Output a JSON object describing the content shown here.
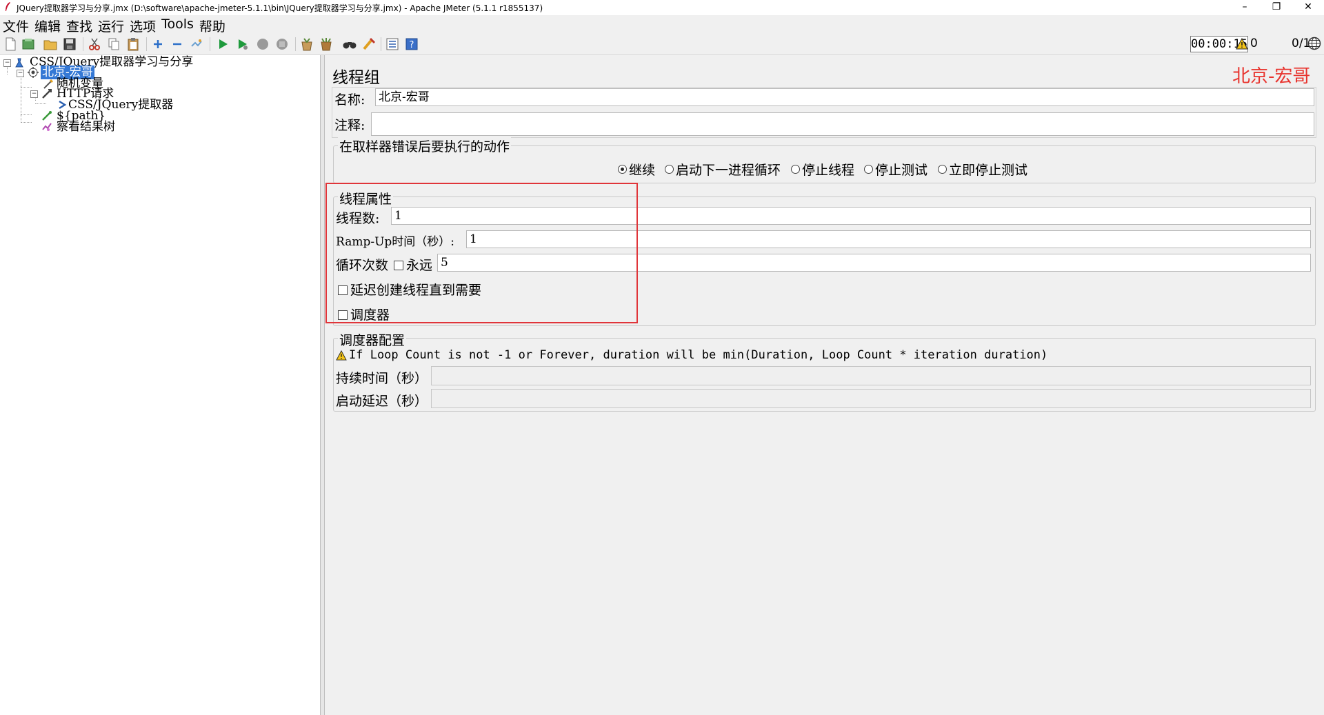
{
  "window": {
    "title": "JQuery提取器学习与分享.jmx (D:\\software\\apache-jmeter-5.1.1\\bin\\JQuery提取器学习与分享.jmx) - Apache JMeter (5.1.1 r1855137)",
    "minimize": "–",
    "maximize": "❐",
    "close": "✕"
  },
  "menu": [
    "文件",
    "编辑",
    "查找",
    "运行",
    "选项",
    "Tools",
    "帮助"
  ],
  "toolbar": {
    "icons": [
      "new-icon",
      "templates-icon",
      "open-icon",
      "save-icon",
      "cut-icon",
      "copy-icon",
      "paste-icon",
      "expand-icon",
      "collapse-icon",
      "toggle-icon",
      "start-icon",
      "start-no-pause-icon",
      "stop-icon",
      "shutdown-icon",
      "clear-icon",
      "clear-all-icon",
      "search-icon",
      "reset-search-icon",
      "function-helper-icon",
      "help-icon"
    ],
    "timer": "00:00:15",
    "warnings": "0",
    "threads": "0/1"
  },
  "tree": {
    "root": "CSS/JQuery提取器学习与分享",
    "thread_group": "北京-宏哥",
    "random_variable": "随机变量",
    "http_request": "HTTP请求",
    "css_extractor": "CSS/JQuery提取器",
    "debug_sampler": "${path}",
    "results_tree": "察看结果树"
  },
  "panel": {
    "heading": "线程组",
    "watermark": "北京-宏哥",
    "name_label": "名称:",
    "name_value": "北京-宏哥",
    "comment_label": "注释:",
    "comment_value": "",
    "error_action": {
      "title": "在取样器错误后要执行的动作",
      "options": [
        "继续",
        "启动下一进程循环",
        "停止线程",
        "停止测试",
        "立即停止测试"
      ],
      "selected": "继续"
    },
    "thread_props": {
      "title": "线程属性",
      "threads_label": "线程数:",
      "threads_value": "1",
      "rampup_label": "Ramp-Up时间（秒）:",
      "rampup_value": "1",
      "loop_label": "循环次数",
      "forever_label": "永远",
      "forever_checked": false,
      "loop_value": "5",
      "delay_label": "延迟创建线程直到需要",
      "delay_checked": false,
      "scheduler_label": "调度器",
      "scheduler_checked": false
    },
    "scheduler": {
      "title": "调度器配置",
      "warning": "If Loop Count is not -1 or Forever, duration will be min(Duration, Loop Count * iteration duration)",
      "duration_label": "持续时间（秒）",
      "duration_value": "",
      "delay_label": "启动延迟（秒）",
      "delay_value": ""
    }
  }
}
